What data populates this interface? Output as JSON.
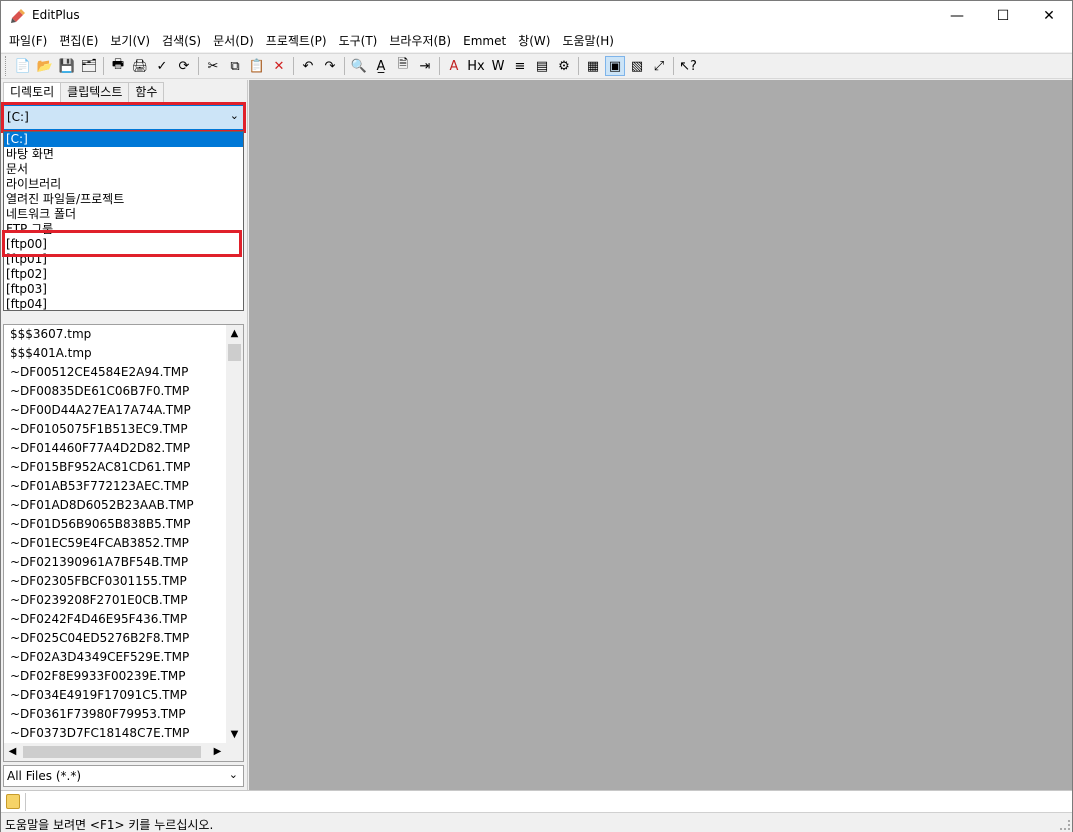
{
  "window": {
    "title": "EditPlus",
    "minimize": "—",
    "maximize": "☐",
    "close": "✕"
  },
  "menu": [
    "파일(F)",
    "편집(E)",
    "보기(V)",
    "검색(S)",
    "문서(D)",
    "프로젝트(P)",
    "도구(T)",
    "브라우저(B)",
    "Emmet",
    "창(W)",
    "도움말(H)"
  ],
  "toolbar": {
    "icons": [
      {
        "name": "new-file-icon",
        "glyph": "📄"
      },
      {
        "name": "open-folder-icon",
        "glyph": "📂"
      },
      {
        "name": "save-icon",
        "glyph": "💾"
      },
      {
        "name": "save-all-icon",
        "glyph": "🗂"
      },
      {
        "sep": true
      },
      {
        "name": "print-preview-icon",
        "glyph": "🖶"
      },
      {
        "name": "print-icon",
        "glyph": "🖨"
      },
      {
        "name": "spellcheck-icon",
        "glyph": "✓"
      },
      {
        "name": "browser-preview-icon",
        "glyph": "⟳"
      },
      {
        "sep": true
      },
      {
        "name": "cut-icon",
        "glyph": "✂"
      },
      {
        "name": "copy-icon",
        "glyph": "⧉"
      },
      {
        "name": "paste-icon",
        "glyph": "📋"
      },
      {
        "name": "delete-icon",
        "glyph": "✕",
        "color": "#d02020"
      },
      {
        "sep": true
      },
      {
        "name": "undo-icon",
        "glyph": "↶"
      },
      {
        "name": "redo-icon",
        "glyph": "↷"
      },
      {
        "sep": true
      },
      {
        "name": "find-icon",
        "glyph": "🔍"
      },
      {
        "name": "replace-icon",
        "glyph": "A̲"
      },
      {
        "name": "find-in-files-icon",
        "glyph": "🗎"
      },
      {
        "name": "goto-line-icon",
        "glyph": "⇥"
      },
      {
        "sep": true
      },
      {
        "name": "font-icon",
        "glyph": "A",
        "color": "#c02020"
      },
      {
        "name": "hex-icon",
        "glyph": "Hx"
      },
      {
        "name": "word-wrap-icon",
        "glyph": "W"
      },
      {
        "name": "line-number-icon",
        "glyph": "≡"
      },
      {
        "name": "ruler-icon",
        "glyph": "▤"
      },
      {
        "name": "settings-icon",
        "glyph": "⚙"
      },
      {
        "sep": true
      },
      {
        "name": "directory-window-icon",
        "glyph": "▦"
      },
      {
        "name": "output-window-icon",
        "glyph": "▣",
        "pressed": true
      },
      {
        "name": "cliptext-icon",
        "glyph": "▧"
      },
      {
        "name": "fullscreen-icon",
        "glyph": "⤢"
      },
      {
        "sep": true
      },
      {
        "name": "help-pointer-icon",
        "glyph": "↖?"
      }
    ]
  },
  "sidebar": {
    "tabs": [
      "디렉토리",
      "클립텍스트",
      "함수"
    ],
    "drive": {
      "value": "[C:]",
      "arrow": "⌄"
    },
    "dropdown": [
      "[C:]",
      "바탕 화면",
      "문서",
      "라이브러리",
      "열려진 파일들/프로젝트",
      "네트워크 폴더",
      "FTP 그룹",
      "[ftp00]",
      "[ftp01]",
      "[ftp02]",
      "[ftp03]",
      "[ftp04]"
    ],
    "selected_index": 0,
    "highlighted_index": 7,
    "files": [
      "$$$3607.tmp",
      "$$$401A.tmp",
      "~DF00512CE4584E2A94.TMP",
      "~DF00835DE61C06B7F0.TMP",
      "~DF00D44A27EA17A74A.TMP",
      "~DF0105075F1B513EC9.TMP",
      "~DF014460F77A4D2D82.TMP",
      "~DF015BF952AC81CD61.TMP",
      "~DF01AB53F772123AEC.TMP",
      "~DF01AD8D6052B23AAB.TMP",
      "~DF01D56B9065B838B5.TMP",
      "~DF01EC59E4FCAB3852.TMP",
      "~DF021390961A7BF54B.TMP",
      "~DF02305FBCF0301155.TMP",
      "~DF0239208F2701E0CB.TMP",
      "~DF0242F4D46E95F436.TMP",
      "~DF025C04ED5276B2F8.TMP",
      "~DF02A3D4349CEF529E.TMP",
      "~DF02F8E9933F00239E.TMP",
      "~DF034E4919F17091C5.TMP",
      "~DF0361F73980F79953.TMP",
      "~DF0373D7FC18148C7E.TMP"
    ],
    "filter": {
      "value": "All Files (*.*)",
      "arrow": "⌄"
    }
  },
  "status": {
    "text": "도움말을 보려면 <F1> 키를 누르십시오."
  }
}
